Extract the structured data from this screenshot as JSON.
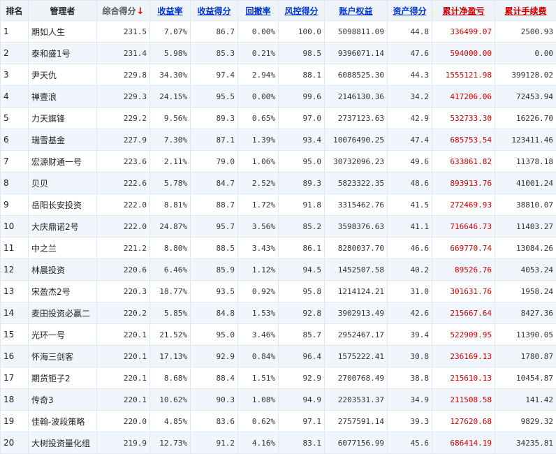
{
  "headers": {
    "rank": "排名",
    "manager": "管理者",
    "composite": "综合得分",
    "composite_arrow": "↓",
    "return_rate": "收益率",
    "return_score": "收益得分",
    "drawdown": "回撤率",
    "risk_score": "风控得分",
    "equity": "账户权益",
    "asset_score": "资产得分",
    "cum_pnl": "累计净盈亏",
    "cum_fee": "累计手续费"
  },
  "rows": [
    {
      "rank": "1",
      "name": "期如人生",
      "composite": "231.5",
      "return_rate": "7.07%",
      "return_score": "86.7",
      "drawdown": "0.00%",
      "risk_score": "100.0",
      "equity": "5098811.09",
      "asset_score": "44.8",
      "cum_pnl": "336499.07",
      "cum_fee": "2500.93"
    },
    {
      "rank": "2",
      "name": "泰和盛1号",
      "composite": "231.4",
      "return_rate": "5.98%",
      "return_score": "85.3",
      "drawdown": "0.21%",
      "risk_score": "98.5",
      "equity": "9396071.14",
      "asset_score": "47.6",
      "cum_pnl": "594000.00",
      "cum_fee": "0.00"
    },
    {
      "rank": "3",
      "name": "尹天仇",
      "composite": "229.8",
      "return_rate": "34.30%",
      "return_score": "97.4",
      "drawdown": "2.94%",
      "risk_score": "88.1",
      "equity": "6088525.30",
      "asset_score": "44.3",
      "cum_pnl": "1555121.98",
      "cum_fee": "399128.02"
    },
    {
      "rank": "4",
      "name": "禅壹浪",
      "composite": "229.3",
      "return_rate": "24.15%",
      "return_score": "95.5",
      "drawdown": "0.00%",
      "risk_score": "99.6",
      "equity": "2146130.36",
      "asset_score": "34.2",
      "cum_pnl": "417206.06",
      "cum_fee": "72453.94"
    },
    {
      "rank": "5",
      "name": "力天旗锋",
      "composite": "229.2",
      "return_rate": "9.56%",
      "return_score": "89.3",
      "drawdown": "0.65%",
      "risk_score": "97.0",
      "equity": "2737123.63",
      "asset_score": "42.9",
      "cum_pnl": "532733.30",
      "cum_fee": "16226.70"
    },
    {
      "rank": "6",
      "name": "瑞雪基金",
      "composite": "227.9",
      "return_rate": "7.30%",
      "return_score": "87.1",
      "drawdown": "1.39%",
      "risk_score": "93.4",
      "equity": "10076490.25",
      "asset_score": "47.4",
      "cum_pnl": "685753.54",
      "cum_fee": "123411.46"
    },
    {
      "rank": "7",
      "name": "宏源财通一号",
      "composite": "223.6",
      "return_rate": "2.11%",
      "return_score": "79.0",
      "drawdown": "1.06%",
      "risk_score": "95.0",
      "equity": "30732096.23",
      "asset_score": "49.6",
      "cum_pnl": "633861.82",
      "cum_fee": "11378.18"
    },
    {
      "rank": "8",
      "name": "贝贝",
      "composite": "222.6",
      "return_rate": "5.78%",
      "return_score": "84.7",
      "drawdown": "2.52%",
      "risk_score": "89.3",
      "equity": "5823322.35",
      "asset_score": "48.6",
      "cum_pnl": "893913.76",
      "cum_fee": "41001.24"
    },
    {
      "rank": "9",
      "name": "岳阳长安投资",
      "composite": "222.0",
      "return_rate": "8.81%",
      "return_score": "88.7",
      "drawdown": "1.72%",
      "risk_score": "91.8",
      "equity": "3315462.76",
      "asset_score": "41.5",
      "cum_pnl": "272469.93",
      "cum_fee": "38810.07"
    },
    {
      "rank": "10",
      "name": "大庆鼎诺2号",
      "composite": "222.0",
      "return_rate": "24.87%",
      "return_score": "95.7",
      "drawdown": "3.56%",
      "risk_score": "85.2",
      "equity": "3598376.63",
      "asset_score": "41.1",
      "cum_pnl": "716646.73",
      "cum_fee": "11403.27"
    },
    {
      "rank": "11",
      "name": "中之兰",
      "composite": "221.2",
      "return_rate": "8.80%",
      "return_score": "88.5",
      "drawdown": "3.43%",
      "risk_score": "86.1",
      "equity": "8280037.70",
      "asset_score": "46.6",
      "cum_pnl": "669770.74",
      "cum_fee": "13084.26"
    },
    {
      "rank": "12",
      "name": "林晨投资",
      "composite": "220.6",
      "return_rate": "6.46%",
      "return_score": "85.9",
      "drawdown": "1.12%",
      "risk_score": "94.5",
      "equity": "1452507.58",
      "asset_score": "40.2",
      "cum_pnl": "89526.76",
      "cum_fee": "4053.24"
    },
    {
      "rank": "13",
      "name": "宋盈杰2号",
      "composite": "220.3",
      "return_rate": "18.77%",
      "return_score": "93.5",
      "drawdown": "0.92%",
      "risk_score": "95.8",
      "equity": "1214124.21",
      "asset_score": "31.0",
      "cum_pnl": "301631.76",
      "cum_fee": "1958.24"
    },
    {
      "rank": "14",
      "name": "麦田投资必赢二",
      "composite": "220.2",
      "return_rate": "5.85%",
      "return_score": "84.8",
      "drawdown": "1.53%",
      "risk_score": "92.8",
      "equity": "3902913.49",
      "asset_score": "42.6",
      "cum_pnl": "215667.64",
      "cum_fee": "8427.36"
    },
    {
      "rank": "15",
      "name": "光环一号",
      "composite": "220.1",
      "return_rate": "21.52%",
      "return_score": "95.0",
      "drawdown": "3.46%",
      "risk_score": "85.7",
      "equity": "2952467.17",
      "asset_score": "39.4",
      "cum_pnl": "522909.95",
      "cum_fee": "11390.05"
    },
    {
      "rank": "16",
      "name": "怀海三剑客",
      "composite": "220.1",
      "return_rate": "17.13%",
      "return_score": "92.9",
      "drawdown": "0.84%",
      "risk_score": "96.4",
      "equity": "1575222.41",
      "asset_score": "30.8",
      "cum_pnl": "236169.13",
      "cum_fee": "1780.87"
    },
    {
      "rank": "17",
      "name": "期货钜子2",
      "composite": "220.1",
      "return_rate": "8.68%",
      "return_score": "88.4",
      "drawdown": "1.51%",
      "risk_score": "92.9",
      "equity": "2700768.49",
      "asset_score": "38.8",
      "cum_pnl": "215610.13",
      "cum_fee": "10454.87"
    },
    {
      "rank": "18",
      "name": "传奇3",
      "composite": "220.1",
      "return_rate": "10.62%",
      "return_score": "90.3",
      "drawdown": "1.08%",
      "risk_score": "94.9",
      "equity": "2203531.37",
      "asset_score": "34.9",
      "cum_pnl": "211508.58",
      "cum_fee": "141.42"
    },
    {
      "rank": "19",
      "name": "佳翰-波段策略",
      "composite": "220.0",
      "return_rate": "4.85%",
      "return_score": "83.6",
      "drawdown": "0.62%",
      "risk_score": "97.1",
      "equity": "2757591.14",
      "asset_score": "39.3",
      "cum_pnl": "127620.68",
      "cum_fee": "9829.32"
    },
    {
      "rank": "20",
      "name": "大树投资量化组",
      "composite": "219.9",
      "return_rate": "12.73%",
      "return_score": "91.2",
      "drawdown": "4.16%",
      "risk_score": "83.1",
      "equity": "6077156.99",
      "asset_score": "45.6",
      "cum_pnl": "686414.19",
      "cum_fee": "34235.81"
    }
  ]
}
